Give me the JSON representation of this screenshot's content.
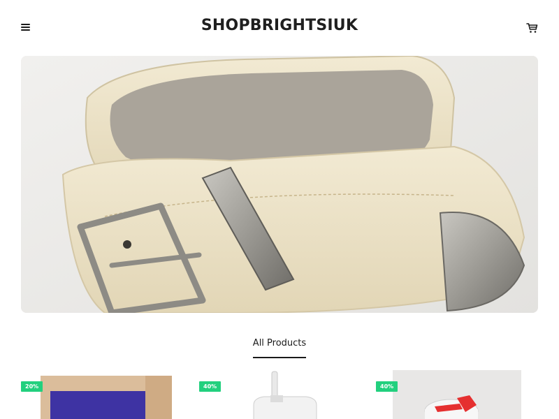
{
  "header": {
    "logo": "SHOPBRIGHTSIUK",
    "menu_icon": "hamburger-menu-icon",
    "cart_icon": "shopping-cart-icon"
  },
  "hero": {
    "image": "cream-leather-belt-photo"
  },
  "section": {
    "tab_label": "All Products"
  },
  "products": [
    {
      "badge": "20%",
      "image": "purple-gift-box-photo"
    },
    {
      "badge": "40%",
      "image": "white-tumbler-straw-photo"
    },
    {
      "badge": "40%",
      "image": "red-lid-tumbler-photo"
    }
  ],
  "colors": {
    "badge_green": "#22d07e",
    "text_dark": "#1a1a1a",
    "belt_cream": "#e9dfc2"
  }
}
